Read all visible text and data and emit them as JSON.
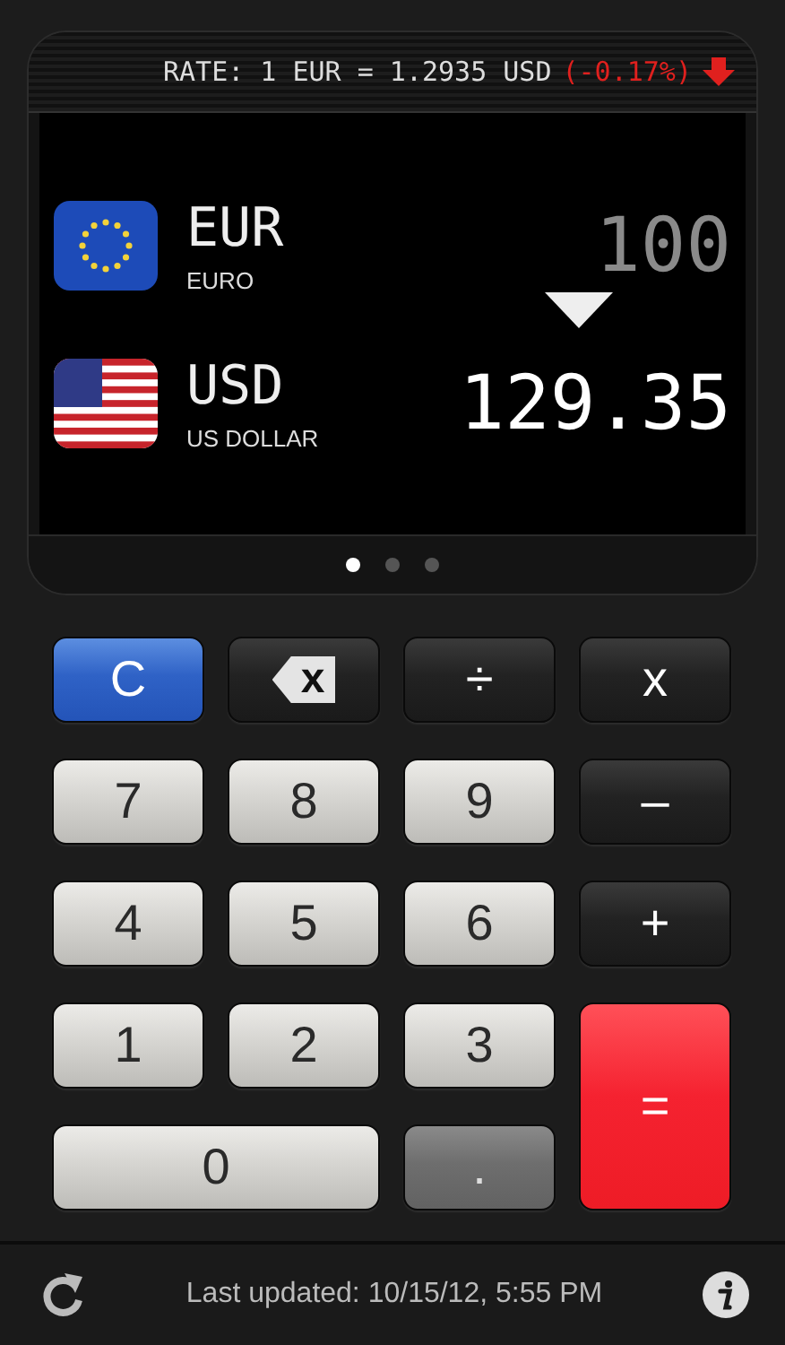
{
  "rate": {
    "text": "RATE: 1 EUR = 1.2935 USD",
    "change": "(-0.17%)",
    "kind": "down"
  },
  "currencies": [
    {
      "code": "EUR",
      "name": "EURO",
      "amount": "100",
      "kind": "eu",
      "highlighted": false
    },
    {
      "code": "USD",
      "name": "US DOLLAR",
      "amount": "129.35",
      "kind": "us",
      "highlighted": true
    }
  ],
  "pages": [
    {
      "selected": true
    },
    {
      "selected": false
    },
    {
      "selected": false
    }
  ],
  "keys": [
    {
      "label": "C",
      "kind": "clear"
    },
    {
      "label": "x",
      "kind": "backspace"
    },
    {
      "label": "÷",
      "kind": "operator"
    },
    {
      "label": "x",
      "kind": "operator"
    },
    {
      "label": "7",
      "kind": "digit"
    },
    {
      "label": "8",
      "kind": "digit"
    },
    {
      "label": "9",
      "kind": "digit"
    },
    {
      "label": "–",
      "kind": "operator"
    },
    {
      "label": "4",
      "kind": "digit"
    },
    {
      "label": "5",
      "kind": "digit"
    },
    {
      "label": "6",
      "kind": "digit"
    },
    {
      "label": "+",
      "kind": "operator"
    },
    {
      "label": "1",
      "kind": "digit"
    },
    {
      "label": "2",
      "kind": "digit"
    },
    {
      "label": "3",
      "kind": "digit"
    },
    {
      "label": "=",
      "kind": "equals"
    },
    {
      "label": "0",
      "kind": "wide"
    },
    {
      "label": ".",
      "kind": "point"
    }
  ],
  "footer": {
    "updated": "Last updated: 10/15/12, 5:55 PM"
  }
}
